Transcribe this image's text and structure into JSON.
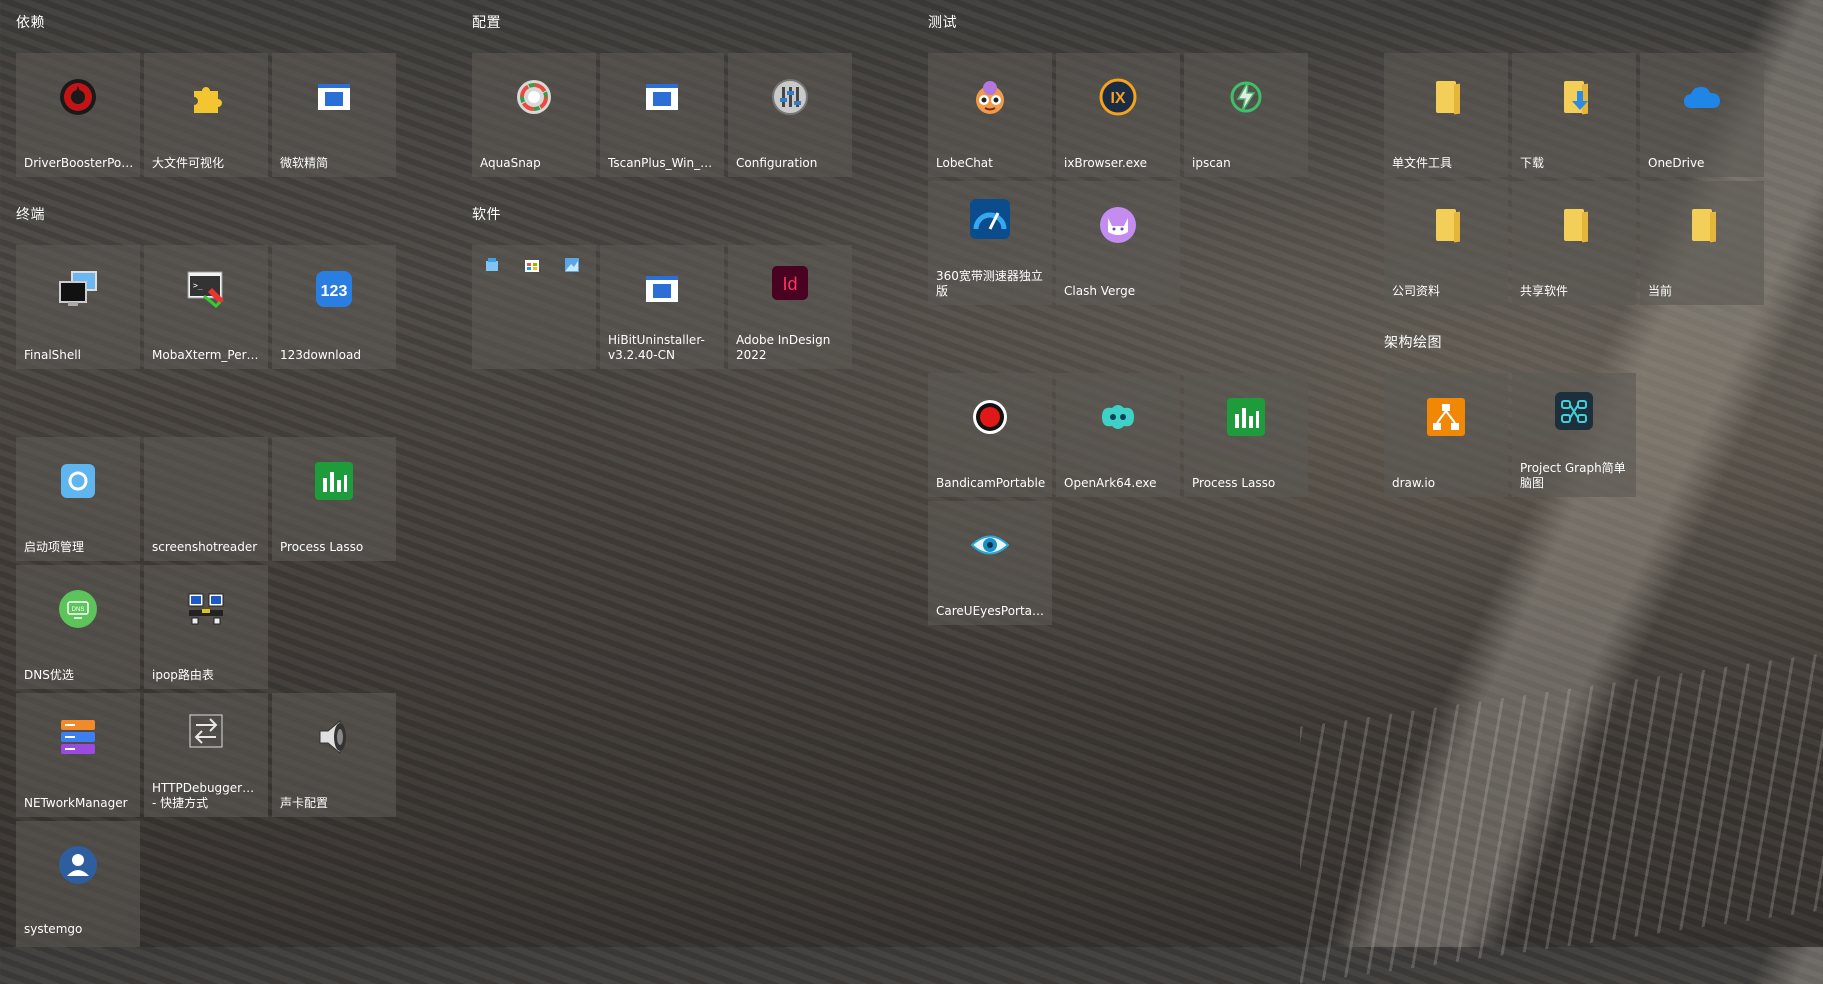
{
  "groups": {
    "yilai": "依赖",
    "peizhi": "配置",
    "ceshi": "测试",
    "zhongduan": "终端",
    "ruanjian": "软件",
    "jiagou": "架构绘图"
  },
  "tiles": {
    "driverbooster": "DriverBoosterPort...",
    "bigfile": "大文件可视化",
    "weiruanjingjian": "微软精简",
    "aquasnap": "AquaSnap",
    "tscanplus": "TscanPlus_Win_A...",
    "configuration": "Configuration",
    "lobechat": "LobeChat",
    "ixbrowser": "ixBrowser.exe",
    "ipscan": "ipscan",
    "danwenjian": "单文件工具",
    "xiazai": "下载",
    "onedrive": "OneDrive",
    "finalshell": "FinalShell",
    "mobaxterm": "MobaXterm_Perso...",
    "download123": "123download",
    "hibit": "HiBitUninstaller-v3.2.40-CN",
    "indesign": "Adobe InDesign 2022",
    "speedtest360": "360宽带测速器独立版",
    "clashverge": "Clash Verge",
    "gongsiziliao": "公司资料",
    "gongxiangruanjian": "共享软件",
    "dangqian": "当前",
    "bandicam": "BandicamPortable",
    "openark": "OpenArk64.exe",
    "processlasso_test": "Process Lasso",
    "drawio": "draw.io",
    "projectgraph": "Project Graph简单脑图",
    "qidongxiang": "启动项管理",
    "screenshotreader": "screenshotreader",
    "processlasso_term": "Process Lasso",
    "careueyes": "CareUEyesPortable",
    "dnsyouxuan": "DNS优选",
    "ipop": "ipop路由表",
    "networkmanager": "NETworkManager",
    "httpdebugger": "HTTPDebuggerUI_... - 快捷方式",
    "shengka": "声卡配置",
    "systemgo": "systemgo"
  },
  "icons": {
    "driverbooster": "driver-booster-icon",
    "bigfile": "puzzle-icon",
    "window": "app-window-icon",
    "aquasnap": "aquasnap-icon",
    "configuration": "configuration-icon",
    "lobechat": "lobechat-icon",
    "ixbrowser": "ixbrowser-icon",
    "ipscan": "ipscan-icon",
    "folder": "folder-icon",
    "onedrive": "onedrive-icon"
  },
  "colors": {
    "tile_bg": "#5c5854",
    "folder": "#f3cf5a",
    "indesign": "#49021f",
    "process_lasso": "#1e9c3c"
  }
}
